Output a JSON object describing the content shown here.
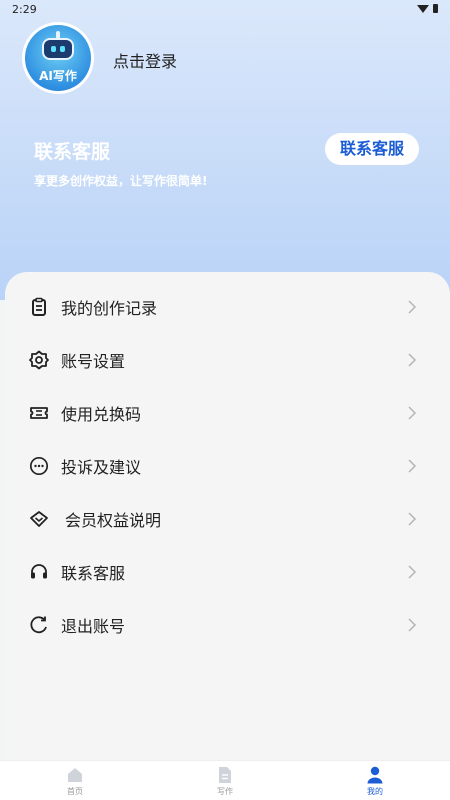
{
  "status_bar": {
    "time": "2:29"
  },
  "profile": {
    "avatar_caption": "AI写作",
    "login_text": "点击登录"
  },
  "vip_banner": {
    "title": "联系客服",
    "subtitle": "享更多创作权益，让写作很简单!",
    "button_label": "联系客服"
  },
  "menu": {
    "items": [
      {
        "label": "我的创作记录",
        "icon": "clipboard-icon"
      },
      {
        "label": "账号设置",
        "icon": "gear-icon"
      },
      {
        "label": "使用兑换码",
        "icon": "ticket-icon"
      },
      {
        "label": "投诉及建议",
        "icon": "chat-bubble-icon"
      },
      {
        "label": "会员权益说明",
        "icon": "diamond-icon"
      },
      {
        "label": "联系客服",
        "icon": "headset-icon"
      },
      {
        "label": "退出账号",
        "icon": "refresh-icon"
      }
    ]
  },
  "bottom_nav": {
    "items": [
      {
        "label": "首页",
        "icon": "home-icon"
      },
      {
        "label": "写作",
        "icon": "document-icon"
      },
      {
        "label": "我的",
        "icon": "user-icon"
      }
    ],
    "active_index": 2
  },
  "colors": {
    "accent": "#1c5dd6",
    "hero_top": "#dbe8fb",
    "hero_bottom": "#b9d3f7"
  }
}
